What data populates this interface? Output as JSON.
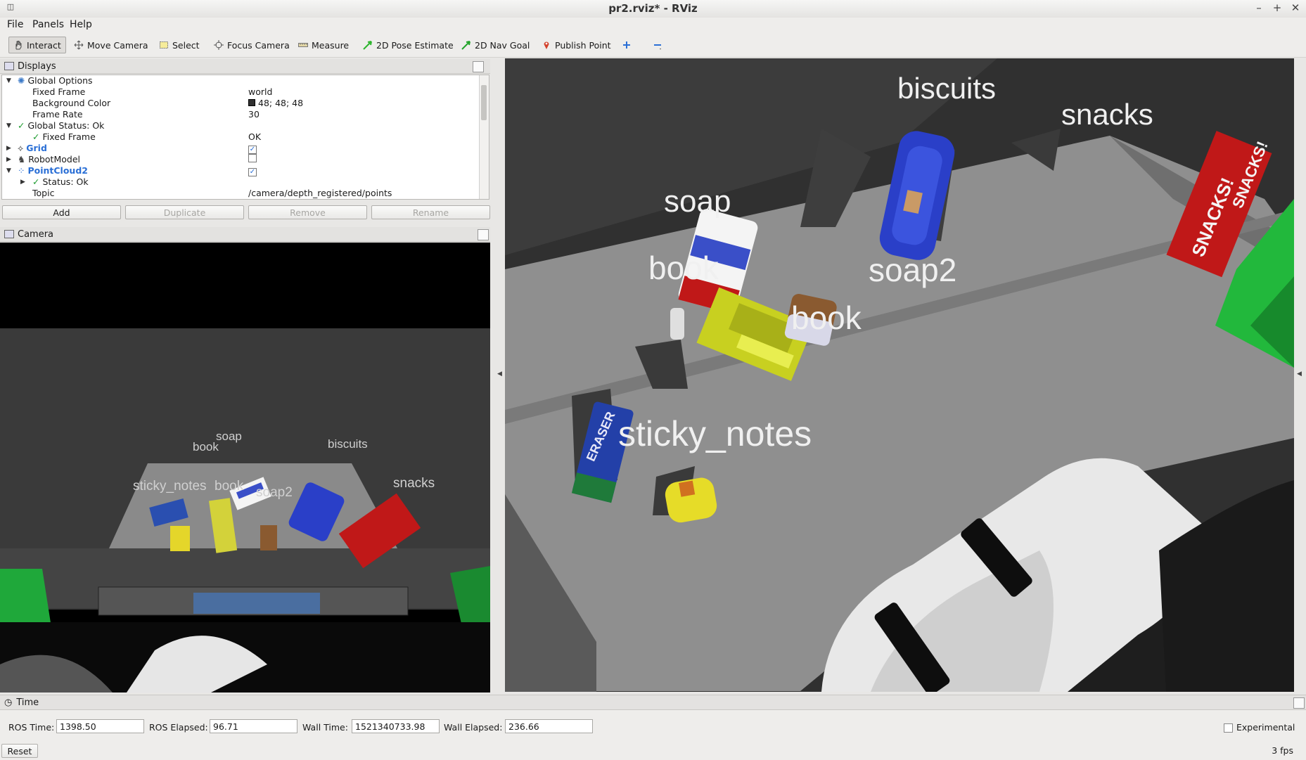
{
  "window": {
    "title": "pr2.rviz* - RViz",
    "controls": [
      "–",
      "+",
      "✕"
    ]
  },
  "menu": [
    "File",
    "Panels",
    "Help"
  ],
  "toolbar": [
    {
      "label": "Interact",
      "icon": "hand-icon"
    },
    {
      "label": "Move Camera",
      "icon": "move-camera-icon"
    },
    {
      "label": "Select",
      "icon": "select-icon"
    },
    {
      "label": "Focus Camera",
      "icon": "focus-camera-icon"
    },
    {
      "label": "Measure",
      "icon": "ruler-icon"
    },
    {
      "label": "2D Pose Estimate",
      "icon": "pose-arrow-icon"
    },
    {
      "label": "2D Nav Goal",
      "icon": "nav-goal-icon"
    },
    {
      "label": "Publish Point",
      "icon": "pin-icon"
    }
  ],
  "displays": {
    "title": "Displays",
    "rows": [
      {
        "key": "Global Options",
        "value": ""
      },
      {
        "key": "Fixed Frame",
        "value": "world"
      },
      {
        "key": "Background Color",
        "value": "48; 48; 48"
      },
      {
        "key": "Frame Rate",
        "value": "30"
      },
      {
        "key": "Global Status: Ok",
        "value": ""
      },
      {
        "key": "Fixed Frame",
        "value": "OK"
      },
      {
        "key": "Grid",
        "value": ""
      },
      {
        "key": "RobotModel",
        "value": ""
      },
      {
        "key": "PointCloud2",
        "value": ""
      },
      {
        "key": "Status: Ok",
        "value": ""
      },
      {
        "key": "Topic",
        "value": "/camera/depth_registered/points"
      }
    ],
    "checkboxes": {
      "grid": "✓",
      "robotmodel": "",
      "pointcloud2": "✓"
    },
    "buttons": [
      "Add",
      "Duplicate",
      "Remove",
      "Rename"
    ]
  },
  "camera": {
    "title": "Camera",
    "labels": [
      "soap",
      "book",
      "biscuits",
      "sticky_notes",
      "book",
      "soap2",
      "snacks"
    ]
  },
  "scene": {
    "labels": [
      "biscuits",
      "snacks",
      "soap",
      "book",
      "soap2",
      "book",
      "sticky_notes"
    ],
    "box_texts": [
      "SNACKS!",
      "SNACKS!",
      "ERASER"
    ]
  },
  "time": {
    "title": "Time",
    "ros_time_label": "ROS Time:",
    "ros_time": "1398.50",
    "ros_elapsed_label": "ROS Elapsed:",
    "ros_elapsed": "96.71",
    "wall_time_label": "Wall Time:",
    "wall_time": "1521340733.98",
    "wall_elapsed_label": "Wall Elapsed:",
    "wall_elapsed": "236.66",
    "experimental": "Experimental",
    "reset": "Reset",
    "fps": "3 fps"
  },
  "colors": {
    "snacks_box": "#c01818",
    "biscuits_box": "#2a3fc8",
    "sticky_notes_box": "#c8d020",
    "table": "#8f8f8f",
    "background": "#303030"
  }
}
